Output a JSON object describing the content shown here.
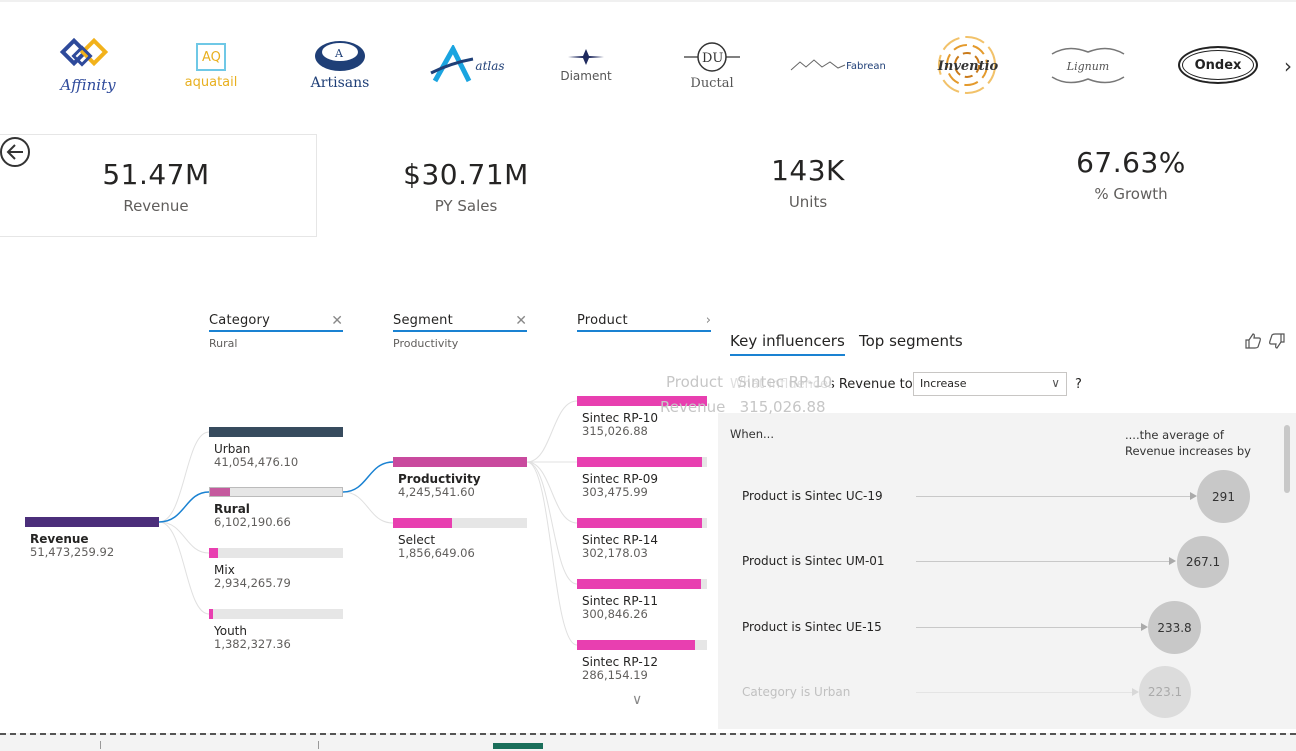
{
  "logos": [
    {
      "name": "Affinity",
      "color": "#2e4a9b"
    },
    {
      "name": "aquatail",
      "color": "#e8b020"
    },
    {
      "name": "Artisans",
      "color": "#1f3f77"
    },
    {
      "name": "atlas",
      "color": "#1f3f77"
    },
    {
      "name": "Diament",
      "color": "#333333"
    },
    {
      "name": "Ductal",
      "color": "#555555"
    },
    {
      "name": "Fabrean",
      "color": "#1f3f77"
    },
    {
      "name": "Inventio",
      "color": "#c58a1a"
    },
    {
      "name": "Lignum",
      "color": "#666666"
    },
    {
      "name": "Ondex",
      "color": "#222222"
    }
  ],
  "kpis": [
    {
      "value": "51.47M",
      "label": "Revenue"
    },
    {
      "value": "$30.71M",
      "label": "PY Sales"
    },
    {
      "value": "143K",
      "label": "Units"
    },
    {
      "value": "67.63%",
      "label": "% Growth"
    }
  ],
  "tree": {
    "root": {
      "label": "Revenue",
      "value": "51,473,259.92",
      "color": "#4b2e7a"
    },
    "levels": [
      {
        "title": "Category",
        "sub": "Rural"
      },
      {
        "title": "Segment",
        "sub": "Productivity"
      },
      {
        "title": "Product",
        "sub": ""
      }
    ],
    "category": [
      {
        "label": "Urban",
        "value": "41,054,476.10",
        "fraction": 1.0,
        "color": "#374b5e"
      },
      {
        "label": "Rural",
        "value": "6,102,190.66",
        "fraction": 0.15,
        "color": "#c55a9e"
      },
      {
        "label": "Mix",
        "value": "2,934,265.79",
        "fraction": 0.07,
        "color": "#e83fb0"
      },
      {
        "label": "Youth",
        "value": "1,382,327.36",
        "fraction": 0.03,
        "color": "#e83fb0"
      }
    ],
    "segment": [
      {
        "label": "Productivity",
        "value": "4,245,541.60",
        "fraction": 1.0,
        "color": "#c94a9e"
      },
      {
        "label": "Select",
        "value": "1,856,649.06",
        "fraction": 0.44,
        "color": "#e83fb0"
      }
    ],
    "product": [
      {
        "label": "Sintec RP-10",
        "value": "315,026.88",
        "fraction": 1.0,
        "color": "#e83fb0"
      },
      {
        "label": "Sintec RP-09",
        "value": "303,475.99",
        "fraction": 0.96,
        "color": "#e83fb0"
      },
      {
        "label": "Sintec RP-14",
        "value": "302,178.03",
        "fraction": 0.96,
        "color": "#e83fb0"
      },
      {
        "label": "Sintec RP-11",
        "value": "300,846.26",
        "fraction": 0.95,
        "color": "#e83fb0"
      },
      {
        "label": "Sintec RP-12",
        "value": "286,154.19",
        "fraction": 0.91,
        "color": "#e83fb0"
      }
    ]
  },
  "tooltip": {
    "product_label": "Product",
    "product_value": "Sintec RP-10",
    "revenue_label": "Revenue",
    "revenue_value": "315,026.88"
  },
  "key_influencers": {
    "tab_active": "Key influencers",
    "tab_other": "Top segments",
    "question": "What influences Revenue to",
    "selected": "Increase",
    "help": "?",
    "when": "When...",
    "avg_header": "....the average of Revenue increases by",
    "rows": [
      {
        "label": "Product is Sintec UC-19",
        "value": "291"
      },
      {
        "label": "Product is Sintec UM-01",
        "value": "267.1"
      },
      {
        "label": "Product is Sintec UE-15",
        "value": "233.8"
      },
      {
        "label": "Category is Urban",
        "value": "223.1"
      }
    ]
  }
}
